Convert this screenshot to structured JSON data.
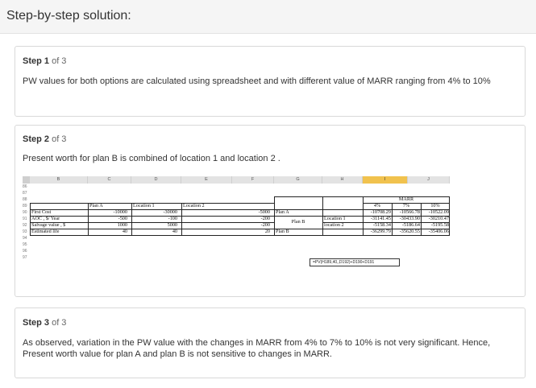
{
  "header": {
    "title": "Step-by-step solution:"
  },
  "steps": [
    {
      "label": "Step 1",
      "of": "of 3",
      "text": "PW values for both options are calculated using spreadsheet and with different value of MARR ranging from 4% to 10%"
    },
    {
      "label": "Step 2",
      "of": "of 3",
      "text": "Present worth for plan B is combined of location 1 and location 2 ."
    },
    {
      "label": "Step 3",
      "of": "of 3",
      "text": "As observed, variation in the PW value with the changes in MARR from 4% to 7% to 10% is not very significant. Hence, Present worth value for plan A and plan B is not sensitive to changes in MARR."
    }
  ],
  "spreadsheet": {
    "columns": [
      "A",
      "B",
      "C",
      "D",
      "E",
      "F",
      "G",
      "H",
      "I",
      "J"
    ],
    "rows": [
      "86",
      "87",
      "88",
      "89",
      "90",
      "91",
      "92",
      "93",
      "94",
      "95",
      "96",
      "97"
    ],
    "left_table": {
      "headers": [
        "Plan A",
        "Location 1",
        "Location 2"
      ],
      "rows": [
        {
          "label": "First Cost",
          "values": [
            "-10000",
            "-30000",
            "-5000"
          ]
        },
        {
          "label": "AOC , $/ Year",
          "values": [
            "-500",
            "-100",
            "-200"
          ]
        },
        {
          "label": "Salvage value , $",
          "values": [
            "1000",
            "5000",
            "-200"
          ]
        },
        {
          "label": "Estimated life",
          "values": [
            "40",
            "40",
            "20"
          ]
        }
      ]
    },
    "right_table": {
      "marr_label": "MARR",
      "rates": [
        "4%",
        "7%",
        "10%"
      ],
      "plan_a": {
        "label": "Plan A",
        "values": [
          "-10708.29",
          "-10566.78",
          "-10522.09"
        ]
      },
      "plan_b_label": "Plan B",
      "location_1": {
        "label": "Location 1",
        "values": [
          "-31141.45",
          "-30433.90",
          "-30210.47"
        ]
      },
      "location_2": {
        "label": "location 2",
        "values": [
          "-5158.34",
          "-5186.64",
          "-5195.58"
        ]
      },
      "plan_b_total": {
        "label": "Plan B",
        "values": [
          "-36299.79",
          "-35620.55",
          "-35406.06"
        ]
      }
    },
    "formula": "=PV(H189,40,,D192)+D190+D191"
  }
}
